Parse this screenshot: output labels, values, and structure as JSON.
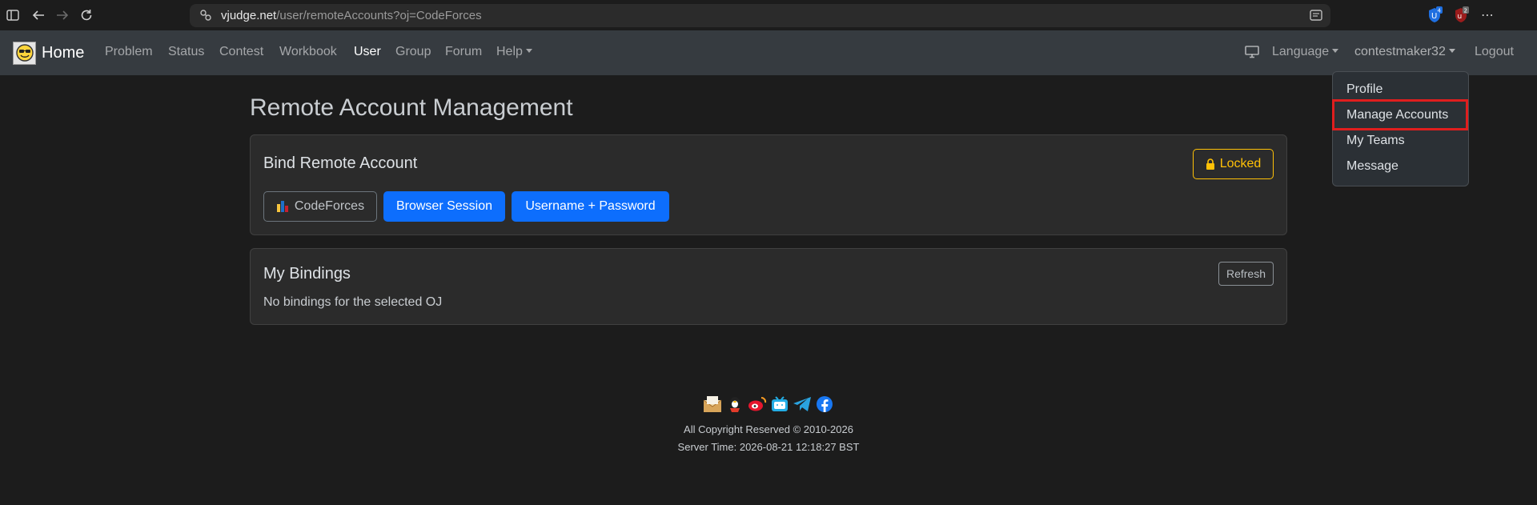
{
  "browser": {
    "url_domain": "vjudge.net",
    "url_path": "/user/remoteAccounts?oj=CodeForces",
    "extension_badges": [
      "4",
      "2"
    ],
    "icons": [
      "sidebar-icon",
      "back-icon",
      "forward-icon",
      "reload-icon",
      "site-info-icon",
      "reader-mode-icon",
      "more-icon"
    ]
  },
  "navbar": {
    "brand": "Home",
    "items": [
      "Problem",
      "Status",
      "Contest",
      "Workbook",
      "User",
      "Group",
      "Forum",
      "Help"
    ],
    "active": "User",
    "language": "Language",
    "username": "contestmaker32",
    "logout": "Logout"
  },
  "dropdown": {
    "items": [
      "Profile",
      "Manage Accounts",
      "My Teams",
      "Message"
    ],
    "highlighted": "Manage Accounts"
  },
  "main": {
    "title": "Remote Account Management",
    "bind_card": {
      "title": "Bind Remote Account",
      "locked_label": "Locked",
      "oj_button": "CodeForces",
      "browser_session": "Browser Session",
      "username_password": "Username + Password"
    },
    "bindings_card": {
      "title": "My Bindings",
      "refresh": "Refresh",
      "empty_text": "No bindings for the selected OJ"
    }
  },
  "footer": {
    "copyright": "All Copyright Reserved © 2010-2026",
    "server_time": "Server Time: 2026-08-21 12:18:27 BST"
  },
  "colors": {
    "page_bg": "#1c1c1c",
    "navbar_bg": "#363b40",
    "card_bg": "#2b2b2b",
    "primary": "#0d6efd",
    "warning": "#ffc107",
    "highlight": "#e01e1e"
  }
}
